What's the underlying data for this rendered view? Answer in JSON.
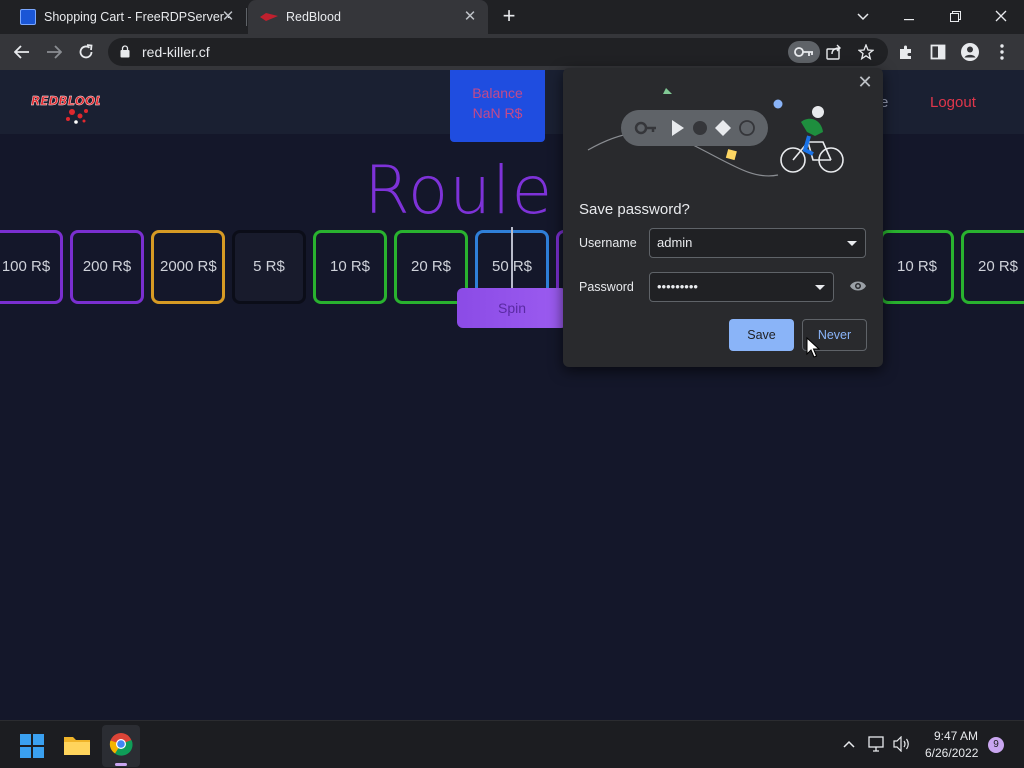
{
  "browser": {
    "tabs": [
      {
        "title": "Shopping Cart - FreeRDPServer -",
        "active": false
      },
      {
        "title": "RedBlood",
        "active": true
      }
    ],
    "close_glyph": "✕",
    "new_tab_glyph": "+",
    "url": "red-killer.cf"
  },
  "site": {
    "logo_text": "REDBLOOD",
    "balance_label": "Balance",
    "balance_value": "NaN R$",
    "nav_partial": "e",
    "logout_label": "Logout",
    "title_visible": "Roule",
    "spin_label": "Spin",
    "roulette_cells": [
      {
        "label": "100 R$",
        "color": "purple"
      },
      {
        "label": "200 R$",
        "color": "purple"
      },
      {
        "label": "2000 R$",
        "color": "gold"
      },
      {
        "label": "5 R$",
        "color": "dark"
      },
      {
        "label": "10 R$",
        "color": "green"
      },
      {
        "label": "20 R$",
        "color": "green"
      },
      {
        "label": "50 R$",
        "color": "blue"
      },
      {
        "label": "10 R$",
        "color": "green"
      },
      {
        "label": "20 R$",
        "color": "green"
      }
    ]
  },
  "password_dialog": {
    "title": "Save password?",
    "username_label": "Username",
    "username_value": "admin",
    "password_label": "Password",
    "password_value": "•••••••••",
    "save_label": "Save",
    "never_label": "Never"
  },
  "taskbar": {
    "time": "9:47 AM",
    "date": "6/26/2022",
    "notification_count": "9"
  },
  "colors": {
    "accent_purple": "#7e32d8",
    "logout_red": "#e0364b",
    "save_blue": "#8ab4f8"
  }
}
